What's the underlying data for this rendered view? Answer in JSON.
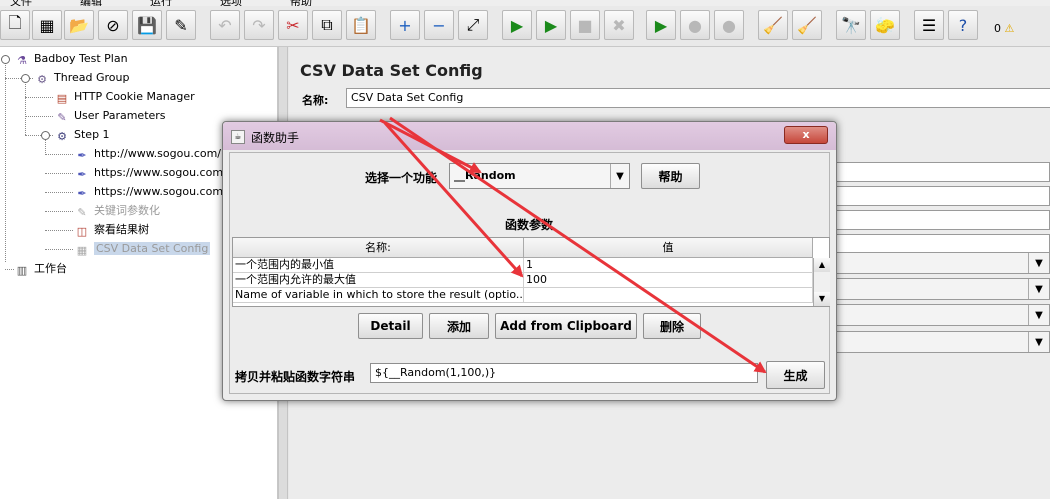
{
  "menubar": {
    "items": [
      "文件",
      "编辑",
      "运行",
      "选项",
      "帮助"
    ]
  },
  "toolbar": {
    "buttons": [
      {
        "name": "new-icon",
        "glyph": "🗋",
        "enabled": true
      },
      {
        "name": "templates-icon",
        "glyph": "▦",
        "enabled": true
      },
      {
        "name": "open-icon",
        "glyph": "📂",
        "enabled": true
      },
      {
        "name": "close-icon",
        "glyph": "⊘",
        "enabled": true
      },
      {
        "name": "save-icon",
        "glyph": "💾",
        "enabled": true
      },
      {
        "name": "save-as-icon",
        "glyph": "✎",
        "enabled": true
      },
      {
        "name": "undo-icon",
        "glyph": "↶",
        "enabled": false
      },
      {
        "name": "redo-icon",
        "glyph": "↷",
        "enabled": false
      },
      {
        "name": "cut-icon",
        "glyph": "✂",
        "enabled": true
      },
      {
        "name": "copy-icon",
        "glyph": "⧉",
        "enabled": true
      },
      {
        "name": "paste-icon",
        "glyph": "📋",
        "enabled": true
      },
      {
        "name": "expand-icon",
        "glyph": "+",
        "enabled": true
      },
      {
        "name": "collapse-icon",
        "glyph": "−",
        "enabled": true
      },
      {
        "name": "toggle-icon",
        "glyph": "⤢",
        "enabled": true
      },
      {
        "name": "start-icon",
        "glyph": "▶",
        "enabled": true
      },
      {
        "name": "start-no-pause-icon",
        "glyph": "▶",
        "enabled": true
      },
      {
        "name": "stop-icon",
        "glyph": "■",
        "enabled": false
      },
      {
        "name": "shutdown-icon",
        "glyph": "✖",
        "enabled": false
      },
      {
        "name": "remote-start-icon",
        "glyph": "▶",
        "enabled": true
      },
      {
        "name": "remote-stop-icon",
        "glyph": "●",
        "enabled": false
      },
      {
        "name": "remote-shutdown-icon",
        "glyph": "●",
        "enabled": false
      },
      {
        "name": "clear-icon",
        "glyph": "🧹",
        "enabled": true
      },
      {
        "name": "clear-all-icon",
        "glyph": "🧹",
        "enabled": true
      },
      {
        "name": "search-icon",
        "glyph": "🔭",
        "enabled": true
      },
      {
        "name": "reset-search-icon",
        "glyph": "🧽",
        "enabled": true
      },
      {
        "name": "function-helper-icon",
        "glyph": "☰",
        "enabled": true
      },
      {
        "name": "help-icon",
        "glyph": "?",
        "enabled": true
      }
    ],
    "warnings_count": "0",
    "warning_glyph": "⚠"
  },
  "tree": {
    "items": [
      {
        "label": "Badboy Test Plan",
        "icon": "flask-icon",
        "glyph": "⚗",
        "disabled": false,
        "selected": false
      },
      {
        "label": "Thread Group",
        "icon": "spool-icon",
        "glyph": "⚙",
        "disabled": false,
        "selected": false
      },
      {
        "label": "HTTP Cookie Manager",
        "icon": "cookie-icon",
        "glyph": "▤",
        "disabled": false,
        "selected": false
      },
      {
        "label": "User Parameters",
        "icon": "syringe-icon",
        "glyph": "✎",
        "disabled": false,
        "selected": false
      },
      {
        "label": "Step 1",
        "icon": "gear-icon",
        "glyph": "⚙",
        "disabled": false,
        "selected": false
      },
      {
        "label": "http://www.sogou.com/",
        "icon": "pipette-icon",
        "glyph": "✒",
        "disabled": false,
        "selected": false
      },
      {
        "label": "https://www.sogou.com/",
        "icon": "pipette-icon",
        "glyph": "✒",
        "disabled": false,
        "selected": false
      },
      {
        "label": "https://www.sogou.com/(",
        "icon": "pipette-icon",
        "glyph": "✒",
        "disabled": false,
        "selected": false
      },
      {
        "label": "关键词参数化",
        "icon": "syringe-icon",
        "glyph": "✎",
        "disabled": true,
        "selected": false
      },
      {
        "label": "察看结果树",
        "icon": "chart-icon",
        "glyph": "◫",
        "disabled": false,
        "selected": false
      },
      {
        "label": "CSV Data Set Config",
        "icon": "csv-icon",
        "glyph": "▦",
        "disabled": true,
        "selected": true
      },
      {
        "label": "工作台",
        "icon": "clipboard-icon",
        "glyph": "▥",
        "disabled": false,
        "selected": false
      }
    ]
  },
  "main": {
    "title": "CSV Data Set Config",
    "name_label": "名称:",
    "name_value": "CSV Data Set Config"
  },
  "dialog": {
    "title": "函数助手",
    "close_label": "x",
    "function_label": "选择一个功能",
    "function_value": "__Random",
    "help_button": "帮助",
    "params_title": "函数参数",
    "columns": [
      "名称:",
      "值"
    ],
    "rows": [
      {
        "name": "一个范围内的最小值",
        "value": "1"
      },
      {
        "name": "一个范围内允许的最大值",
        "value": "100"
      },
      {
        "name": "Name of variable in which to store the result (optio...",
        "value": ""
      }
    ],
    "buttons": {
      "detail": "Detail",
      "add": "添加",
      "clipboard": "Add from Clipboard",
      "delete": "删除"
    },
    "copy_label": "拷贝并粘贴函数字符串",
    "copy_value": "${__Random(1,100,)}",
    "generate_button": "生成"
  },
  "colors": {
    "annotation_arrow": "#e8343a",
    "dialog_titlebar": "#d9c1d9",
    "selection": "#c8d7ea"
  }
}
